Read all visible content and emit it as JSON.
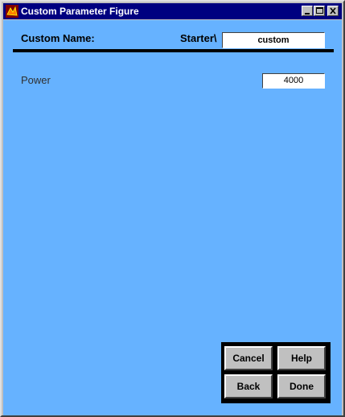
{
  "window": {
    "title": "Custom Parameter Figure",
    "icons": [
      "matlab-app-icon",
      "minimize-icon",
      "maximize-icon",
      "close-icon"
    ]
  },
  "header": {
    "custom_name_label": "Custom Name:",
    "starter_label": "Starter\\",
    "custom_name_value": "custom"
  },
  "parameters": [
    {
      "label": "Power",
      "value": "4000"
    }
  ],
  "buttons": {
    "cancel": "Cancel",
    "help": "Help",
    "back": "Back",
    "done": "Done"
  },
  "colors": {
    "background": "#66b2ff",
    "titlebar": "#000080"
  }
}
